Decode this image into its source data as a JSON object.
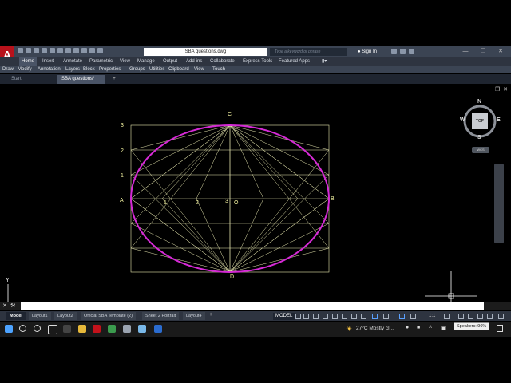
{
  "app": {
    "logo_letter": "A",
    "document_title": "SBA questions.dwg",
    "search_placeholder": "Type a keyword or phrase",
    "sign_in": "Sign In"
  },
  "ribbon": {
    "tabs": [
      "Home",
      "Insert",
      "Annotate",
      "Parametric",
      "View",
      "Manage",
      "Output",
      "Add-ins",
      "Collaborate",
      "Express Tools",
      "Featured Apps"
    ],
    "active_tab": "Home",
    "panels": [
      "Draw",
      "Modify",
      "Annotation",
      "Layers",
      "Block",
      "Properties",
      "Groups",
      "Utilities",
      "Clipboard",
      "View",
      "Touch"
    ]
  },
  "file_tabs": {
    "start": "Start",
    "active": "SBA questions*",
    "add": "+"
  },
  "viewcube": {
    "north": "N",
    "south": "S",
    "east": "E",
    "west": "W",
    "face": "TOP",
    "wcs": "WCS"
  },
  "drawing": {
    "labels": {
      "top": "C",
      "bottom": "D",
      "left": "A",
      "right": "B",
      "center": "O",
      "rows": [
        "3",
        "2",
        "1"
      ],
      "axis": [
        "1",
        "2",
        "3"
      ]
    },
    "colors": {
      "ellipse": "#d62ad6",
      "construction": "#e8e8b0"
    },
    "ucs_y": "Y"
  },
  "status": {
    "layout_tabs": [
      "Model",
      "Layout1",
      "Layout2",
      "Official SBA Template (2)",
      "Sheet 2 Portrait",
      "Layout4"
    ],
    "active_layout": "Model",
    "model_button": "MODEL",
    "scale": "1:1"
  },
  "taskbar": {
    "temperature": "27°C",
    "weather": "Mostly cl...",
    "tooltip": "Speakers: 96%"
  }
}
